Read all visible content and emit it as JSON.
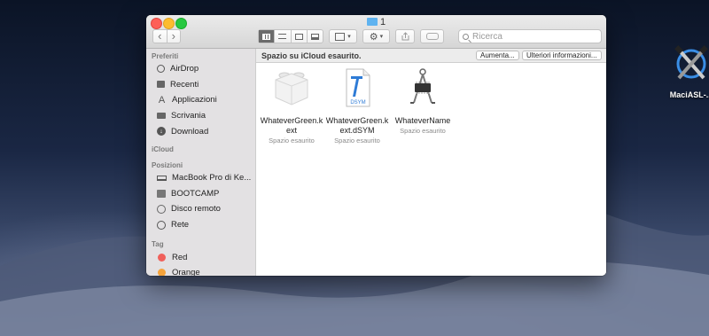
{
  "desktop": {
    "icon_label": "MaciASL-..."
  },
  "window": {
    "title": "1",
    "search_placeholder": "Ricerca",
    "banner": {
      "message": "Spazio su iCloud esaurito.",
      "btn_increase": "Aumenta...",
      "btn_more": "Ulteriori informazioni..."
    }
  },
  "sidebar": {
    "favorites_label": "Preferiti",
    "favorites": [
      {
        "label": "AirDrop"
      },
      {
        "label": "Recenti"
      },
      {
        "label": "Applicazioni"
      },
      {
        "label": "Scrivania"
      },
      {
        "label": "Download"
      }
    ],
    "icloud_label": "iCloud",
    "locations_label": "Posizioni",
    "locations": [
      {
        "label": "MacBook Pro di Ke..."
      },
      {
        "label": "BOOTCAMP"
      },
      {
        "label": "Disco remoto"
      },
      {
        "label": "Rete"
      }
    ],
    "tags_label": "Tag",
    "tags": [
      {
        "label": "Red",
        "color": "#f0605b"
      },
      {
        "label": "Orange",
        "color": "#f5a33b"
      }
    ]
  },
  "files": [
    {
      "name_line1": "WhateverGreen.k",
      "name_line2": "ext",
      "status": "Spazio esaurito"
    },
    {
      "name_line1": "WhateverGreen.k",
      "name_line2": "ext.dSYM",
      "status": "Spazio esaurito",
      "badge": "DSYM"
    },
    {
      "name_line1": "WhateverName",
      "name_line2": "",
      "status": "Spazio esaurito"
    }
  ]
}
